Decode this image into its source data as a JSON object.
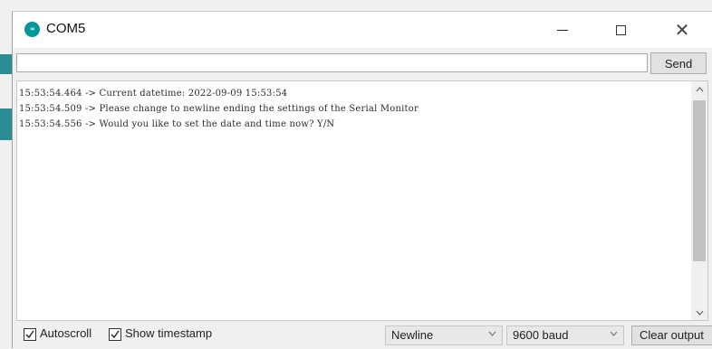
{
  "window": {
    "title": "COM5",
    "logo_icon": "arduino-logo-icon",
    "logo_glyph": "∞",
    "minimize_glyph": "—",
    "maximize_glyph": "☐",
    "close_glyph": "✕"
  },
  "input": {
    "value": "",
    "send_label": "Send"
  },
  "output": {
    "lines": [
      "15:53:54.464 -> Current datetime: 2022-09-09 15:53:54",
      "15:53:54.509 -> Please change to newline ending the settings of the Serial Monitor",
      "15:53:54.556 -> Would you like to set the date and time now? Y/N"
    ],
    "scroll_up_glyph": "^",
    "scroll_down_glyph": "v"
  },
  "bottom": {
    "autoscroll": {
      "label": "Autoscroll",
      "checked": true
    },
    "show_timestamp": {
      "label": "Show timestamp",
      "checked": true
    },
    "line_ending": {
      "selected": "Newline",
      "arrow": "v"
    },
    "baud_rate": {
      "selected": "9600 baud",
      "arrow": "v"
    },
    "clear_label": "Clear output"
  },
  "colors": {
    "arduino_teal": "#00979c",
    "background_strip": "#2a8d95"
  }
}
